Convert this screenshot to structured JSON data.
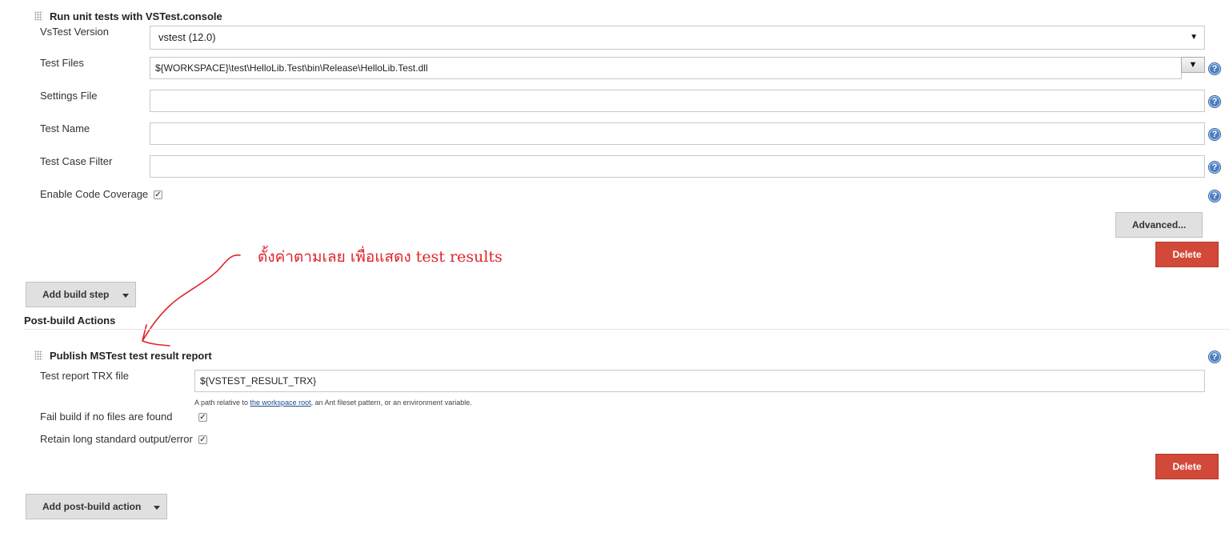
{
  "vstest": {
    "title": "Run unit tests with VSTest.console",
    "version_label": "VsTest Version",
    "version_value": "vstest (12.0)",
    "test_files_label": "Test Files",
    "test_files_value": "${WORKSPACE}\\test\\HelloLib.Test\\bin\\Release\\HelloLib.Test.dll",
    "settings_label": "Settings File",
    "settings_value": "",
    "test_name_label": "Test Name",
    "test_name_value": "",
    "filter_label": "Test Case Filter",
    "filter_value": "",
    "coverage_label": "Enable Code Coverage",
    "coverage_checked": true,
    "advanced_label": "Advanced...",
    "delete_label": "Delete"
  },
  "annotation": {
    "text": "ตั้งค่าตามเลย เพื่อแสดง test results",
    "color": "#e0232a"
  },
  "add_build_step_label": "Add build step",
  "post_build_heading": "Post-build Actions",
  "mstest": {
    "title": "Publish MSTest test result report",
    "trx_label": "Test report TRX file",
    "trx_value": "${VSTEST_RESULT_TRX}",
    "hint_prefix": "A path relative to ",
    "hint_link": "the workspace root",
    "hint_suffix": ", an Ant fileset pattern, or an environment variable.",
    "fail_label": "Fail build if no files are found",
    "fail_checked": true,
    "retain_label": "Retain long standard output/error",
    "retain_checked": true,
    "delete_label": "Delete"
  },
  "add_post_build_label": "Add post-build action",
  "colors": {
    "delete_red": "#d24939",
    "help_blue": "#4a7fc1",
    "button_grey": "#e0e0e0"
  }
}
